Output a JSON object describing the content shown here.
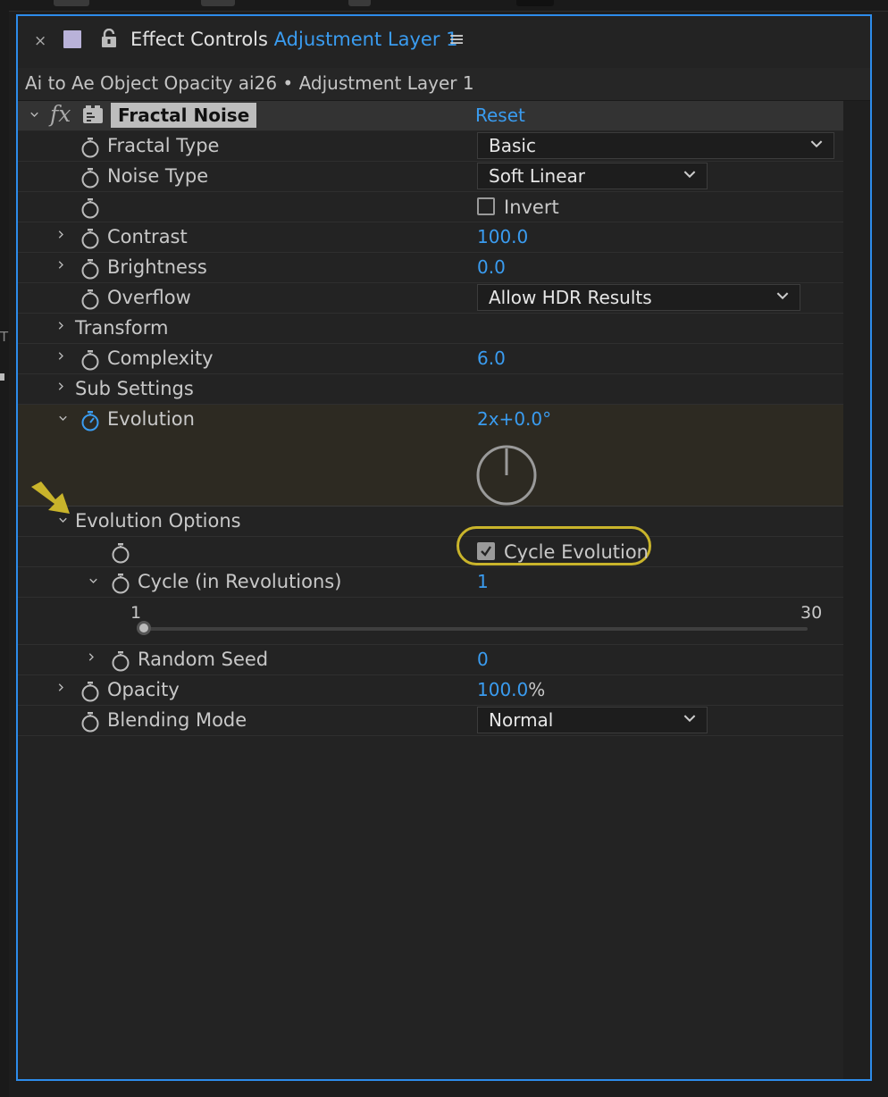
{
  "window": {
    "tab_close": "×",
    "tab_title": "Effect Controls",
    "tab_layer": "Adjustment Layer 1",
    "menu_icon": "≡",
    "subtitle": "Ai to Ae Object Opacity ai26 • Adjustment Layer 1",
    "left_edge_letter": "T"
  },
  "effect": {
    "fx_glyph": "fx",
    "name": "Fractal Noise",
    "reset_label": "Reset",
    "properties": {
      "fractal_type": {
        "label": "Fractal Type",
        "value": "Basic"
      },
      "noise_type": {
        "label": "Noise Type",
        "value": "Soft Linear"
      },
      "invert": {
        "label": "Invert",
        "checked": false
      },
      "contrast": {
        "label": "Contrast",
        "value": "100.0"
      },
      "brightness": {
        "label": "Brightness",
        "value": "0.0"
      },
      "overflow": {
        "label": "Overflow",
        "value": "Allow HDR Results"
      },
      "transform": {
        "label": "Transform"
      },
      "complexity": {
        "label": "Complexity",
        "value": "6.0"
      },
      "sub_settings": {
        "label": "Sub Settings"
      },
      "evolution": {
        "label": "Evolution",
        "value": "2x+0.0°",
        "dial_angle_deg": 0
      },
      "evolution_options": {
        "label": "Evolution Options"
      },
      "cycle_evolution": {
        "label": "Cycle Evolution",
        "checked": true
      },
      "cycle_revolutions": {
        "label": "Cycle (in Revolutions)",
        "value": "1",
        "slider_min": "1",
        "slider_max": "30"
      },
      "random_seed": {
        "label": "Random Seed",
        "value": "0"
      },
      "opacity": {
        "label": "Opacity",
        "value": "100.0",
        "unit": "%"
      },
      "blending_mode": {
        "label": "Blending Mode",
        "value": "Normal"
      }
    }
  },
  "colors": {
    "accent_blue": "#3a9cf0",
    "panel_border": "#2d8ceb",
    "highlight_yellow": "#c9b42b",
    "annotation_arrow": "#c9b42b"
  }
}
